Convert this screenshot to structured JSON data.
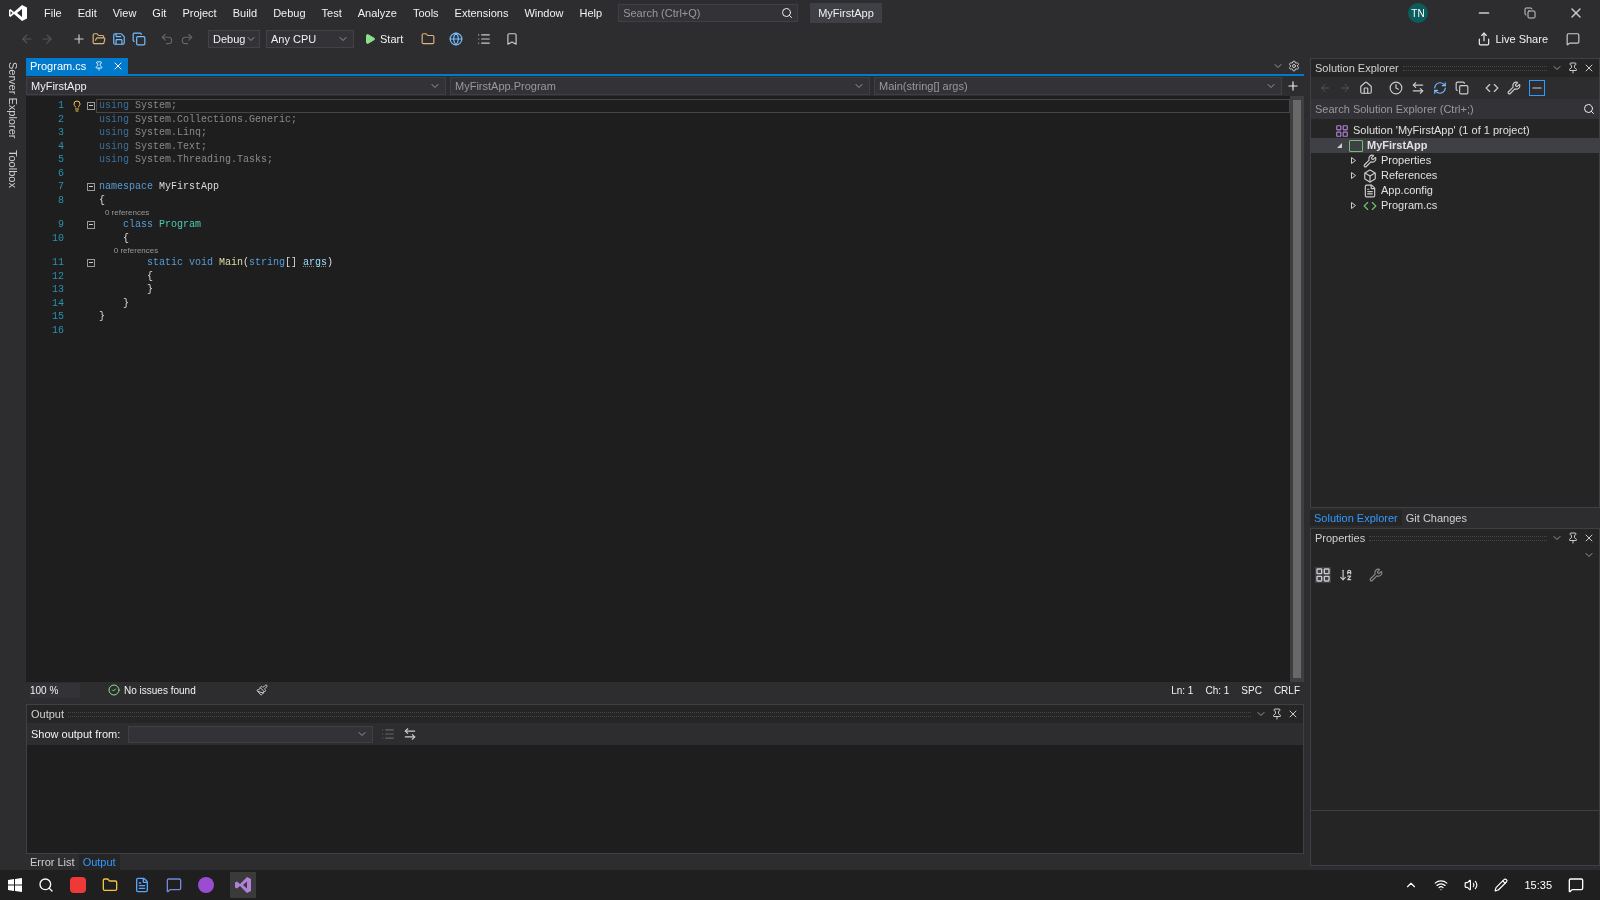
{
  "window": {
    "title": "MyFirstApp",
    "search_placeholder": "Search (Ctrl+Q)",
    "user_initials": "TN"
  },
  "menu": [
    "File",
    "Edit",
    "View",
    "Git",
    "Project",
    "Build",
    "Debug",
    "Test",
    "Analyze",
    "Tools",
    "Extensions",
    "Window",
    "Help"
  ],
  "toolbar": {
    "configuration": "Debug",
    "platform": "Any CPU",
    "start": "Start",
    "live_share": "Live Share"
  },
  "side_tabs": [
    "Server Explorer",
    "Toolbox"
  ],
  "editor": {
    "tabs": [
      {
        "label": "Program.cs",
        "selected": true
      }
    ],
    "nav": {
      "project": "MyFirstApp",
      "type": "MyFirstApp.Program",
      "member": "Main(string[] args)"
    },
    "lines": [
      {
        "kind": "code",
        "number": "1",
        "fold": true,
        "current": true,
        "bulb": true,
        "tokens": [
          {
            "kind": "keyword-faded",
            "text": "using"
          },
          {
            "kind": "faded",
            "text": " System;"
          }
        ]
      },
      {
        "kind": "code",
        "number": "2",
        "fold": false,
        "current": false,
        "bulb": false,
        "tokens": [
          {
            "kind": "keyword-faded",
            "text": "using"
          },
          {
            "kind": "faded",
            "text": " System.Collections.Generic;"
          }
        ]
      },
      {
        "kind": "code",
        "number": "3",
        "fold": false,
        "current": false,
        "bulb": false,
        "tokens": [
          {
            "kind": "keyword-faded",
            "text": "using"
          },
          {
            "kind": "faded",
            "text": " System.Linq;"
          }
        ]
      },
      {
        "kind": "code",
        "number": "4",
        "fold": false,
        "current": false,
        "bulb": false,
        "tokens": [
          {
            "kind": "keyword-faded",
            "text": "using"
          },
          {
            "kind": "faded",
            "text": " System.Text;"
          }
        ]
      },
      {
        "kind": "code",
        "number": "5",
        "fold": false,
        "current": false,
        "bulb": false,
        "tokens": [
          {
            "kind": "keyword-faded",
            "text": "using"
          },
          {
            "kind": "faded",
            "text": " System.Threading.Tasks;"
          }
        ]
      },
      {
        "kind": "code",
        "number": "6",
        "fold": false,
        "current": false,
        "bulb": false
      },
      {
        "kind": "code",
        "number": "7",
        "fold": true,
        "current": false,
        "bulb": false,
        "tokens": [
          {
            "kind": "keyword",
            "text": "namespace"
          },
          {
            "kind": "plain",
            "text": " MyFirstApp"
          }
        ]
      },
      {
        "kind": "code",
        "number": "8",
        "fold": false,
        "current": false,
        "bulb": false,
        "tokens": [
          {
            "kind": "plain",
            "text": "{"
          }
        ]
      },
      {
        "kind": "codelens",
        "text": "    0 references"
      },
      {
        "kind": "code",
        "number": "9",
        "fold": true,
        "current": false,
        "bulb": false,
        "tokens": [
          {
            "kind": "keyword",
            "text": "    class "
          },
          {
            "kind": "type",
            "text": "Program"
          }
        ]
      },
      {
        "kind": "code",
        "number": "10",
        "fold": false,
        "current": false,
        "bulb": false,
        "tokens": [
          {
            "kind": "plain",
            "text": "    {"
          }
        ]
      },
      {
        "kind": "codelens",
        "text": "        0 references"
      },
      {
        "kind": "code",
        "number": "11",
        "fold": true,
        "current": false,
        "bulb": false,
        "tokens": [
          {
            "kind": "keyword",
            "text": "        static void "
          },
          {
            "kind": "method",
            "text": "Main"
          },
          {
            "kind": "plain",
            "text": "("
          },
          {
            "kind": "keyword",
            "text": "string"
          },
          {
            "kind": "plain",
            "text": "[] "
          },
          {
            "kind": "param-unused",
            "text": "args"
          },
          {
            "kind": "plain",
            "text": ")"
          }
        ]
      },
      {
        "kind": "code",
        "number": "12",
        "fold": false,
        "current": false,
        "bulb": false,
        "tokens": [
          {
            "kind": "plain",
            "text": "        {"
          }
        ]
      },
      {
        "kind": "code",
        "number": "13",
        "fold": false,
        "current": false,
        "bulb": false,
        "tokens": [
          {
            "kind": "plain",
            "text": "        }"
          }
        ]
      },
      {
        "kind": "code",
        "number": "14",
        "fold": false,
        "current": false,
        "bulb": false,
        "tokens": [
          {
            "kind": "plain",
            "text": "    }"
          }
        ]
      },
      {
        "kind": "code",
        "number": "15",
        "fold": false,
        "current": false,
        "bulb": false,
        "tokens": [
          {
            "kind": "plain",
            "text": "}"
          }
        ]
      },
      {
        "kind": "code",
        "number": "16",
        "fold": false,
        "current": false,
        "bulb": false
      }
    ],
    "status": {
      "zoom": "100 %",
      "issues": "No issues found",
      "line": "Ln: 1",
      "column": "Ch: 1",
      "whitespace": "SPC",
      "line_endings": "CRLF"
    }
  },
  "output": {
    "title": "Output",
    "show_from_label": "Show output from:"
  },
  "bottom_tabs": [
    {
      "label": "Error List",
      "selected": false
    },
    {
      "label": "Output",
      "selected": true
    }
  ],
  "solution_explorer": {
    "title": "Solution Explorer",
    "search_placeholder": "Search Solution Explorer (Ctrl+;)",
    "tree": [
      {
        "kind": "solution",
        "label": "Solution 'MyFirstApp' (1 of 1 project)",
        "selected": false,
        "children": [
          {
            "kind": "project",
            "label": "MyFirstApp",
            "expanded": true,
            "selected": true,
            "children": [
              {
                "kind": "properties",
                "label": "Properties",
                "expanded": false,
                "selected": false
              },
              {
                "kind": "references",
                "label": "References",
                "expanded": false,
                "selected": false
              },
              {
                "kind": "config",
                "label": "App.config",
                "selected": false
              },
              {
                "kind": "csfile",
                "label": "Program.cs",
                "expanded": false,
                "selected": false
              }
            ]
          }
        ]
      }
    ]
  },
  "right_tabs": [
    {
      "label": "Solution Explorer",
      "selected": true
    },
    {
      "label": "Git Changes",
      "selected": false
    }
  ],
  "properties": {
    "title": "Properties"
  },
  "taskbar": {
    "time": "15:35"
  }
}
